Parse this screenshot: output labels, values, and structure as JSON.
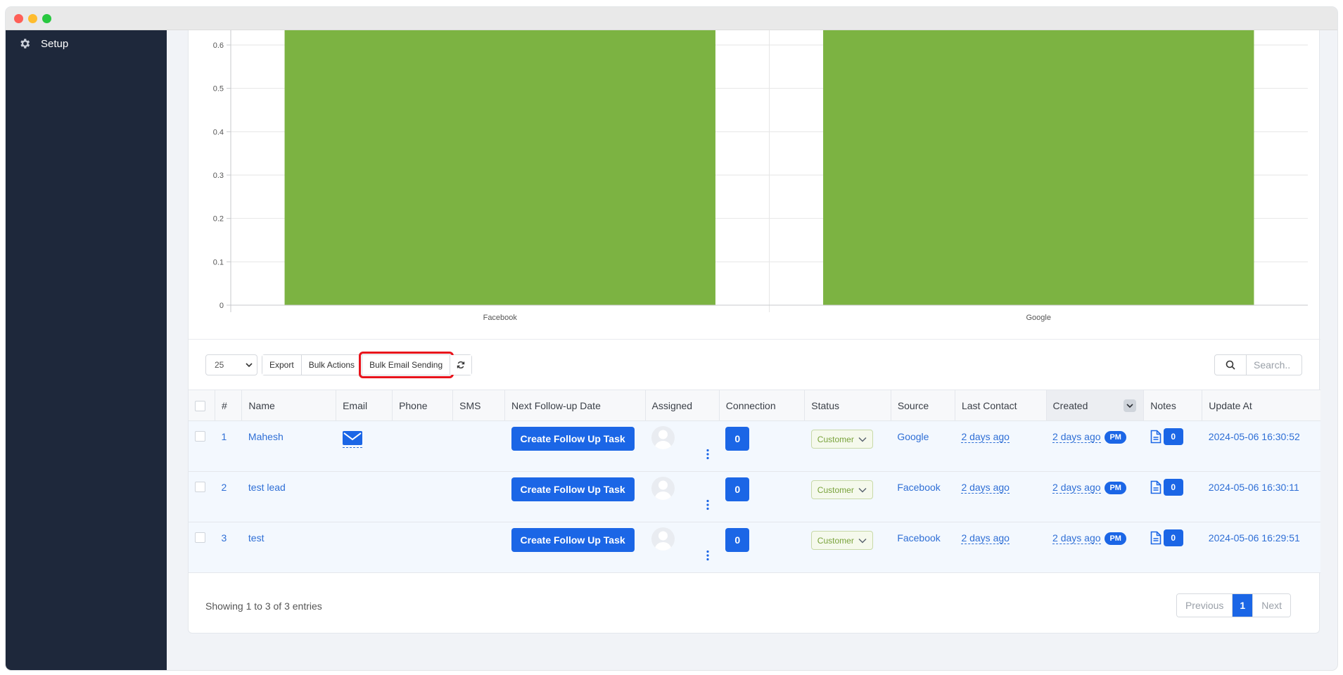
{
  "sidebar": {
    "items": [
      {
        "label": "Setup",
        "icon": "gear-icon"
      }
    ]
  },
  "chart_data": {
    "type": "bar",
    "categories": [
      "Facebook",
      "Google"
    ],
    "values": [
      1,
      1
    ],
    "ylim": [
      0,
      0.6
    ],
    "yticks": [
      "0",
      "0.1",
      "0.2",
      "0.3",
      "0.4",
      "0.5",
      "0.6"
    ],
    "color": "#7cb342",
    "grid": true,
    "clipped_top": true
  },
  "toolbar": {
    "page_length": "25",
    "export_label": "Export",
    "bulk_actions_label": "Bulk Actions",
    "bulk_email_label": "Bulk Email Sending",
    "search_placeholder": "Search.."
  },
  "table": {
    "headers": [
      "#",
      "Name",
      "Email",
      "Phone",
      "SMS",
      "Next Follow-up Date",
      "Assigned",
      "Connection",
      "Status",
      "Source",
      "Last Contact",
      "Created",
      "Notes",
      "Update At"
    ],
    "rows": [
      {
        "num": "1",
        "name": "Mahesh",
        "followup": "Create Follow Up Task",
        "connection": "0",
        "status": "Customer",
        "source": "Google",
        "last_contact": "2 days ago",
        "created": "2 days ago",
        "created_badge": "PM",
        "notes": "0",
        "update_at": "2024-05-06 16:30:52",
        "has_email": true
      },
      {
        "num": "2",
        "name": "test lead",
        "followup": "Create Follow Up Task",
        "connection": "0",
        "status": "Customer",
        "source": "Facebook",
        "last_contact": "2 days ago",
        "created": "2 days ago",
        "created_badge": "PM",
        "notes": "0",
        "update_at": "2024-05-06 16:30:11",
        "has_email": false
      },
      {
        "num": "3",
        "name": "test",
        "followup": "Create Follow Up Task",
        "connection": "0",
        "status": "Customer",
        "source": "Facebook",
        "last_contact": "2 days ago",
        "created": "2 days ago",
        "created_badge": "PM",
        "notes": "0",
        "update_at": "2024-05-06 16:29:51",
        "has_email": false
      }
    ]
  },
  "footer": {
    "info": "Showing 1 to 3 of 3 entries",
    "prev_label": "Previous",
    "current_page": "1",
    "next_label": "Next"
  }
}
